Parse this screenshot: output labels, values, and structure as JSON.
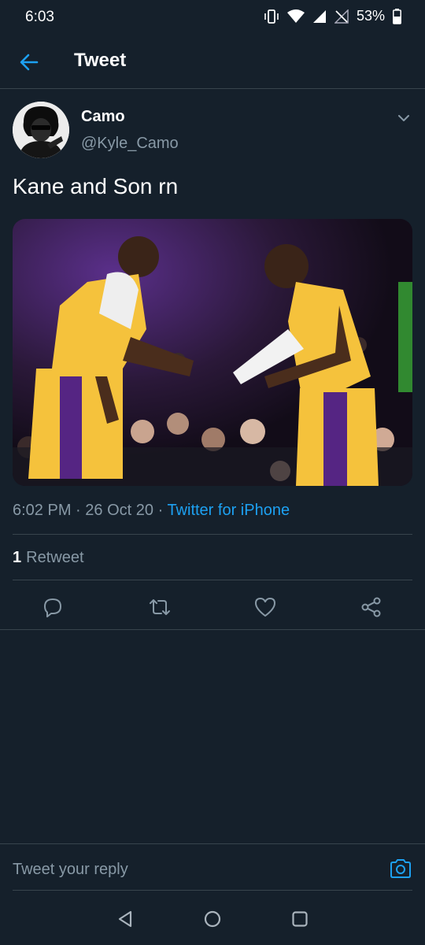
{
  "status_bar": {
    "time": "6:03",
    "battery_percent": "53%"
  },
  "header": {
    "title": "Tweet",
    "back_icon": "arrow-left-icon"
  },
  "tweet": {
    "author": {
      "name": "Camo",
      "handle": "@Kyle_Camo"
    },
    "text": "Kane and Son rn",
    "media_description_icon": "photo",
    "time": "6:02 PM",
    "separator": "·",
    "date": "26 Oct 20",
    "source": "Twitter for iPhone",
    "retweets": {
      "count": "1",
      "label": "Retweet"
    }
  },
  "actions": [
    "reply-icon",
    "retweet-icon",
    "like-icon",
    "share-icon"
  ],
  "reply": {
    "placeholder": "Tweet your reply",
    "camera_icon": "camera-icon"
  },
  "nav": [
    "back-triangle-icon",
    "home-circle-icon",
    "recents-square-icon"
  ],
  "colors": {
    "background": "#15202b",
    "accent": "#1da1f2",
    "muted": "#8899a6",
    "divider": "#38444d"
  }
}
